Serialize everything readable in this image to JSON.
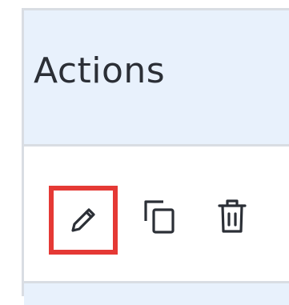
{
  "table": {
    "header": {
      "actions_label": "Actions"
    },
    "row": {
      "actions": [
        {
          "icon": "edit-icon",
          "highlighted": true
        },
        {
          "icon": "copy-icon",
          "highlighted": false
        },
        {
          "icon": "delete-icon",
          "highlighted": false
        }
      ]
    }
  },
  "colors": {
    "header_background": "#e8f1fc",
    "border": "#d9dde3",
    "highlight": "#e53935",
    "icon": "#2b2f36"
  }
}
